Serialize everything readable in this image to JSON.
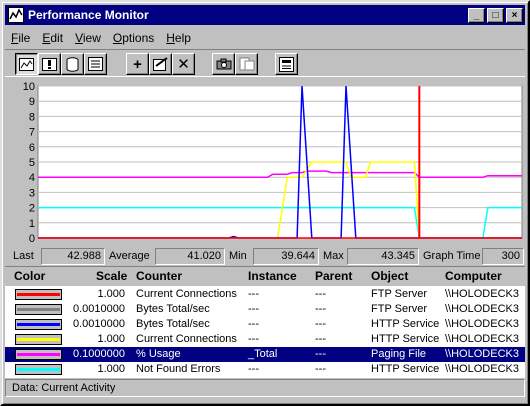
{
  "window": {
    "title": "Performance Monitor",
    "controls": [
      "_",
      "□",
      "×"
    ]
  },
  "menu": [
    {
      "u": "F",
      "rest": "ile"
    },
    {
      "u": "E",
      "rest": "dit"
    },
    {
      "u": "V",
      "rest": "iew"
    },
    {
      "u": "O",
      "rest": "ptions"
    },
    {
      "u": "H",
      "rest": "elp"
    }
  ],
  "toolbar": {
    "add_label": "+",
    "delete_label": "✕",
    "icons": [
      "chart-view-icon",
      "alert-view-icon",
      "log-view-icon",
      "report-view-icon",
      "add-counter-icon",
      "edit-counter-icon",
      "delete-counter-icon",
      "snapshot-icon",
      "bookmark-icon",
      "options-icon"
    ]
  },
  "chart_data": {
    "type": "line",
    "y_ticks": [
      "0",
      "1",
      "2",
      "3",
      "4",
      "5",
      "6",
      "7",
      "8",
      "9",
      "10"
    ],
    "ylim": [
      0,
      10
    ],
    "x_count": 100,
    "grid": true,
    "current_marker_index": 78,
    "series": [
      {
        "color": "#ff00ff",
        "values": [
          4,
          4,
          4,
          4,
          4,
          4,
          4,
          4,
          4,
          4,
          4,
          4,
          4,
          4,
          4,
          4,
          4,
          4,
          4,
          4,
          4,
          4,
          4,
          4,
          4,
          4,
          4,
          4,
          4,
          4,
          4,
          4,
          4,
          4,
          4,
          4,
          4,
          4,
          4,
          4,
          4,
          4,
          4,
          4,
          4,
          4,
          4,
          4,
          4.2,
          4.2,
          4.2,
          4.2,
          4.3,
          4.3,
          4.3,
          4.4,
          4.4,
          4.4,
          4.4,
          4.4,
          4.3,
          4.3,
          4.3,
          4.3,
          4.3,
          4.3,
          4.3,
          4.3,
          4.3,
          4.3,
          4.3,
          4.3,
          4.3,
          4.3,
          4.3,
          4.3,
          4.3,
          4.3,
          4,
          4,
          4,
          4,
          4,
          4,
          4,
          4,
          4,
          4,
          4,
          4,
          4,
          4,
          4.1,
          4.1,
          4.1,
          4.1,
          4.1,
          4.1,
          4.1,
          4.1
        ]
      },
      {
        "color": "#00ffff",
        "values": [
          2,
          2,
          2,
          2,
          2,
          2,
          2,
          2,
          2,
          2,
          2,
          2,
          2,
          2,
          2,
          2,
          2,
          2,
          2,
          2,
          2,
          2,
          2,
          2,
          2,
          2,
          2,
          2,
          2,
          2,
          2,
          2,
          2,
          2,
          2,
          2,
          2,
          2,
          2,
          2,
          2,
          2,
          2,
          2,
          2,
          2,
          2,
          2,
          2,
          2,
          2,
          2,
          2,
          2,
          2,
          2,
          2,
          2,
          2,
          2,
          2,
          2,
          2,
          2,
          2,
          2,
          2,
          2,
          2,
          2,
          2,
          2,
          2,
          2,
          2,
          2,
          2,
          2,
          0,
          0,
          0,
          0,
          0,
          0,
          0,
          0,
          0,
          0,
          0,
          0,
          0,
          0,
          2,
          2,
          2,
          2,
          2,
          2,
          2,
          2
        ]
      },
      {
        "color": "#ffff00",
        "values": [
          0,
          0,
          0,
          0,
          0,
          0,
          0,
          0,
          0,
          0,
          0,
          0,
          0,
          0,
          0,
          0,
          0,
          0,
          0,
          0,
          0,
          0,
          0,
          0,
          0,
          0,
          0,
          0,
          0,
          0,
          0,
          0,
          0,
          0,
          0,
          0,
          0,
          0,
          0,
          0,
          0,
          0,
          0,
          0,
          0,
          0,
          0,
          0,
          0,
          0,
          2,
          4,
          4,
          4,
          4,
          4.5,
          5,
          5,
          5,
          5,
          5,
          5,
          5,
          5,
          4,
          4,
          4,
          4,
          5,
          5,
          5,
          5,
          5,
          5,
          5,
          5,
          5,
          5,
          0,
          0,
          0,
          0,
          0,
          0,
          0,
          0,
          0,
          0,
          0,
          0,
          0,
          0,
          0,
          0,
          0,
          0,
          0,
          0,
          0,
          0
        ]
      },
      {
        "color": "#0000ff",
        "values": [
          0,
          0,
          0,
          0,
          0,
          0,
          0,
          0,
          0,
          0,
          0,
          0,
          0,
          0,
          0,
          0,
          0,
          0,
          0,
          0,
          0,
          0,
          0,
          0,
          0,
          0,
          0,
          0,
          0,
          0,
          0,
          0,
          0,
          0,
          0,
          0,
          0,
          0,
          0,
          0,
          0.1,
          0,
          0,
          0,
          0,
          0,
          0,
          0,
          0,
          0,
          0,
          0,
          0,
          0,
          10,
          5,
          0,
          0,
          0,
          0,
          0,
          0,
          0,
          10,
          5,
          0,
          0,
          0,
          0,
          0,
          0,
          0,
          0,
          0,
          0,
          0,
          0,
          0,
          0,
          0,
          0,
          0,
          0,
          0,
          0,
          0,
          0,
          0,
          0,
          0,
          0,
          0,
          0,
          0,
          0,
          0,
          0,
          0,
          0,
          0
        ]
      },
      {
        "color": "#ff0000",
        "values": [
          0,
          0,
          0,
          0,
          0,
          0,
          0,
          0,
          0,
          0,
          0,
          0,
          0,
          0,
          0,
          0,
          0,
          0,
          0,
          0,
          0,
          0,
          0,
          0,
          0,
          0,
          0,
          0,
          0,
          0,
          0,
          0,
          0,
          0,
          0,
          0,
          0,
          0,
          0,
          0,
          0,
          0,
          0,
          0,
          0,
          0,
          0,
          0,
          0,
          0,
          0,
          0,
          0,
          0,
          0,
          0,
          0,
          0,
          0,
          0,
          0,
          0,
          0,
          0,
          0,
          0,
          0,
          0,
          0,
          0,
          0,
          0,
          0,
          0,
          0,
          0,
          0,
          0,
          0,
          0,
          0,
          0,
          0,
          0,
          0,
          0,
          0,
          0,
          0,
          0,
          0,
          0,
          0,
          0,
          0,
          0,
          0,
          0,
          0,
          0
        ]
      }
    ]
  },
  "stats": {
    "last_label": "Last",
    "last_value": "42.988",
    "average_label": "Average",
    "average_value": "41.020",
    "min_label": "Min",
    "min_value": "39.644",
    "max_label": "Max",
    "max_value": "43.345",
    "graph_time_label": "Graph Time",
    "graph_time_value": "300"
  },
  "legend": {
    "headers": {
      "color": "Color",
      "scale": "Scale",
      "counter": "Counter",
      "instance": "Instance",
      "parent": "Parent",
      "object": "Object",
      "computer": "Computer"
    },
    "rows": [
      {
        "color": "#ff0000",
        "scale": "1.000",
        "counter": "Current Connections",
        "instance": "---",
        "parent": "---",
        "object": "FTP Server",
        "computer": "\\\\HOLODECK3",
        "selected": false
      },
      {
        "color": "#808080",
        "scale": "0.0010000",
        "counter": "Bytes Total/sec",
        "instance": "---",
        "parent": "---",
        "object": "FTP Server",
        "computer": "\\\\HOLODECK3",
        "selected": false
      },
      {
        "color": "#0000ff",
        "scale": "0.0010000",
        "counter": "Bytes Total/sec",
        "instance": "---",
        "parent": "---",
        "object": "HTTP Service",
        "computer": "\\\\HOLODECK3",
        "selected": false
      },
      {
        "color": "#ffff00",
        "scale": "1.000",
        "counter": "Current Connections",
        "instance": "---",
        "parent": "---",
        "object": "HTTP Service",
        "computer": "\\\\HOLODECK3",
        "selected": false
      },
      {
        "color": "#ff00ff",
        "scale": "0.1000000",
        "counter": "% Usage",
        "instance": "_Total",
        "parent": "---",
        "object": "Paging File",
        "computer": "\\\\HOLODECK3",
        "selected": true
      },
      {
        "color": "#00ffff",
        "scale": "1.000",
        "counter": "Not Found Errors",
        "instance": "---",
        "parent": "---",
        "object": "HTTP Service",
        "computer": "\\\\HOLODECK3",
        "selected": false
      }
    ]
  },
  "status": "Data: Current Activity"
}
